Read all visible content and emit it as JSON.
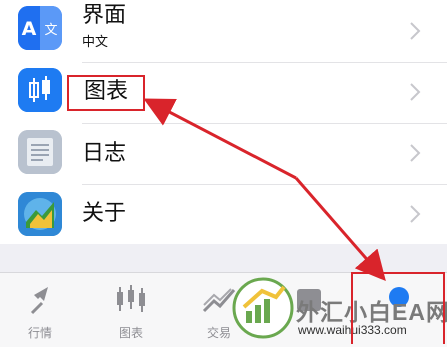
{
  "settings": {
    "items": [
      {
        "label": "界面",
        "sublabel": "中文",
        "icon": "translate-icon"
      },
      {
        "label": "图表",
        "icon": "candlestick-chart-icon"
      },
      {
        "label": "日志",
        "icon": "journal-icon"
      },
      {
        "label": "关于",
        "icon": "metatrader-app-icon"
      }
    ]
  },
  "tabbar": {
    "tabs": [
      {
        "label": "行情",
        "icon": "quotes-arrows-icon"
      },
      {
        "label": "图表",
        "icon": "chart-candles-icon"
      },
      {
        "label": "交易",
        "icon": "trade-icon"
      },
      {
        "label": "",
        "icon": "history-icon"
      },
      {
        "label": "",
        "icon": "settings-icon"
      }
    ]
  },
  "watermark": {
    "title": "外汇小白EA网",
    "url": "www.waihui333.com"
  },
  "colors": {
    "annotation_red": "#d9242b",
    "chevron": "#c7c7cc",
    "tab_gray": "#8e8e93",
    "accent_blue": "#1e7bf2"
  }
}
